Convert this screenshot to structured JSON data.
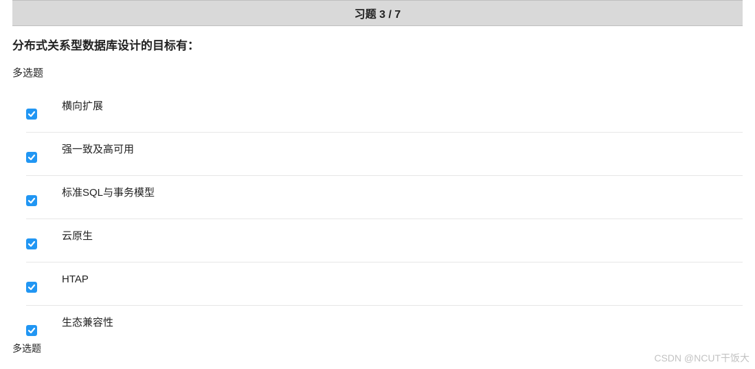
{
  "header": {
    "title": "习题 3 / 7"
  },
  "question": {
    "title": "分布式关系型数据库设计的目标有：",
    "type": "多选题"
  },
  "options": [
    {
      "label": "横向扩展",
      "checked": true
    },
    {
      "label": "强一致及高可用",
      "checked": true
    },
    {
      "label": "标准SQL与事务模型",
      "checked": true
    },
    {
      "label": "云原生",
      "checked": true
    },
    {
      "label": "HTAP",
      "checked": true
    },
    {
      "label": "生态兼容性",
      "checked": true
    }
  ],
  "footer": {
    "type": "多选题"
  },
  "watermark": "CSDN @NCUT干饭大",
  "colors": {
    "checkbox": "#2196f3"
  }
}
